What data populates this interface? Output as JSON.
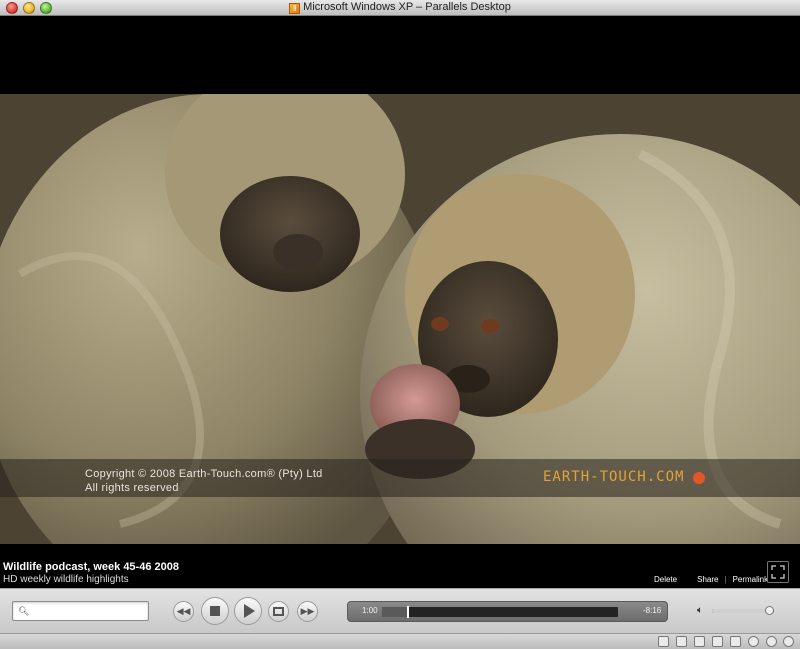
{
  "window": {
    "title": "Microsoft Windows XP – Parallels Desktop"
  },
  "video": {
    "copyright_line1": "Copyright © 2008 Earth-Touch.com® (Pty) Ltd",
    "copyright_line2": "All rights reserved",
    "brand": "EARTH-TOUCH.COM"
  },
  "info": {
    "title": "Wildlife podcast, week 45-46 2008",
    "subtitle": "HD weekly wildlife highlights",
    "delete_label": "Delete",
    "share_label": "Share",
    "separator": "|",
    "permalink_label": "Permalink"
  },
  "controls": {
    "search_value": "",
    "current_time": "1:00",
    "remaining_time": "-8:16",
    "progress_fraction": 0.105,
    "loaded_fraction": 0.105,
    "volume_fraction": 0.93
  },
  "statusbar": {
    "icons": [
      "keyboard-icon",
      "floppy-icon",
      "device-icon",
      "cd-icon",
      "printer-icon",
      "network-icon",
      "sync-icon",
      "usb-icon"
    ]
  },
  "colors": {
    "brand_orange": "#e3a23a",
    "brand_dot": "#e2572a"
  }
}
